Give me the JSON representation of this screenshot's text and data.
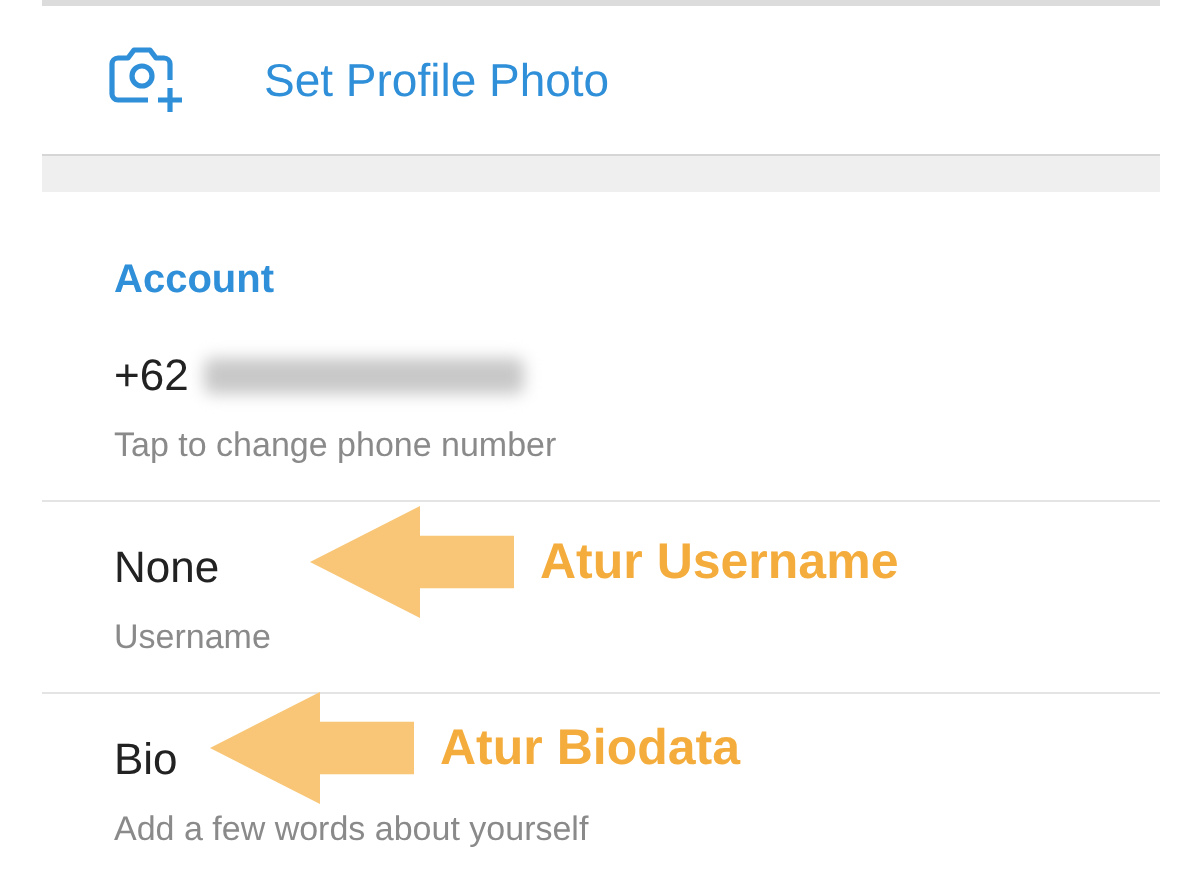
{
  "profile_photo": {
    "label": "Set Profile Photo"
  },
  "account": {
    "header": "Account",
    "rows": [
      {
        "kind": "phone",
        "value": "+62",
        "subtitle": "Tap to change phone number"
      },
      {
        "kind": "field",
        "value": "None",
        "subtitle": "Username",
        "annotation": "Atur Username"
      },
      {
        "kind": "field",
        "value": "Bio",
        "subtitle": "Add a few words about yourself",
        "annotation": "Atur Biodata"
      }
    ]
  }
}
